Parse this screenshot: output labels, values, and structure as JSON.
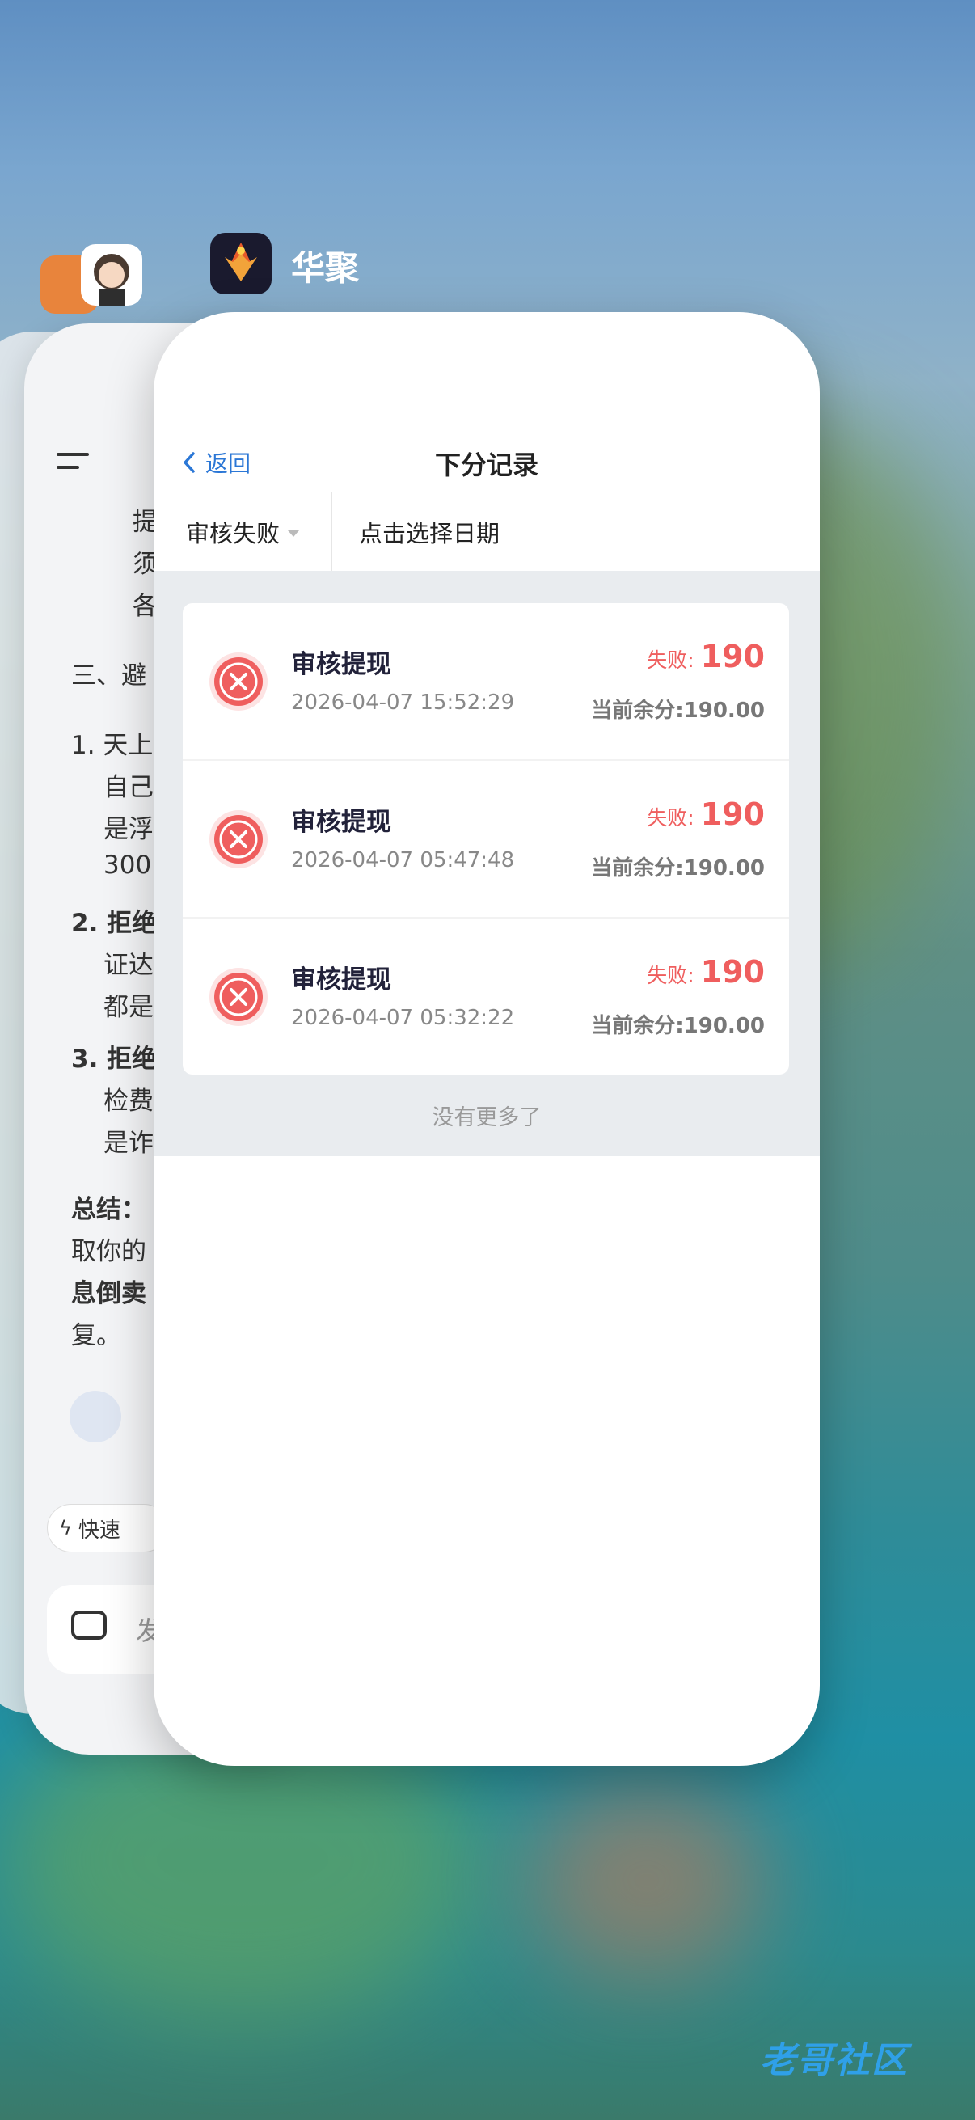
{
  "background_apps": {
    "middle_card": {
      "lines": [
        "提",
        "须",
        "各",
        "三、避",
        "1. 天上",
        "自己",
        "是浮",
        "300",
        "2. 拒绝",
        "证达",
        "都是",
        "3. 拒绝",
        "检费",
        "是诈",
        "总结：",
        "取你的",
        "息倒卖",
        "复。",
        "快速",
        "发"
      ]
    }
  },
  "app_switcher": {
    "front_app_name": "华聚"
  },
  "page": {
    "back_label": "返回",
    "title": "下分记录",
    "filter_status": "审核失败",
    "filter_date": "点击选择日期",
    "records": [
      {
        "title": "审核提现",
        "time": "2026-04-07 15:52:29",
        "amount_label": "失败:",
        "amount": "190",
        "balance": "当前余分:190.00"
      },
      {
        "title": "审核提现",
        "time": "2026-04-07 05:47:48",
        "amount_label": "失败:",
        "amount": "190",
        "balance": "当前余分:190.00"
      },
      {
        "title": "审核提现",
        "time": "2026-04-07 05:32:22",
        "amount_label": "失败:",
        "amount": "190",
        "balance": "当前余分:190.00"
      }
    ],
    "no_more": "没有更多了"
  },
  "watermark": "老哥社区",
  "colors": {
    "accent_blue": "#2b77d6",
    "fail_red": "#ef5e5e"
  }
}
